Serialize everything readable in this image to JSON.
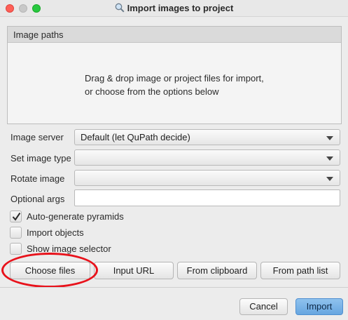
{
  "window": {
    "title": "Import images to project",
    "title_icon": "magnifier-icon"
  },
  "image_paths": {
    "header": "Image paths",
    "hint_line1": "Drag & drop image or project files for import,",
    "hint_line2": "or choose from the options below"
  },
  "form": {
    "image_server": {
      "label": "Image server",
      "value": "Default (let QuPath decide)"
    },
    "image_type": {
      "label": "Set image type",
      "value": ""
    },
    "rotate": {
      "label": "Rotate image",
      "value": ""
    },
    "optional_args": {
      "label": "Optional args",
      "value": ""
    }
  },
  "options": [
    {
      "label": "Auto-generate pyramids",
      "checked": true
    },
    {
      "label": "Import objects",
      "checked": false
    },
    {
      "label": "Show image selector",
      "checked": false
    }
  ],
  "source_buttons": {
    "choose_files": "Choose files",
    "input_url": "Input URL",
    "from_clipboard": "From clipboard",
    "from_path_list": "From path list"
  },
  "footer": {
    "cancel": "Cancel",
    "import": "Import"
  },
  "colors": {
    "annotation": "#e8121b",
    "primary_button": "#67a6e0"
  }
}
